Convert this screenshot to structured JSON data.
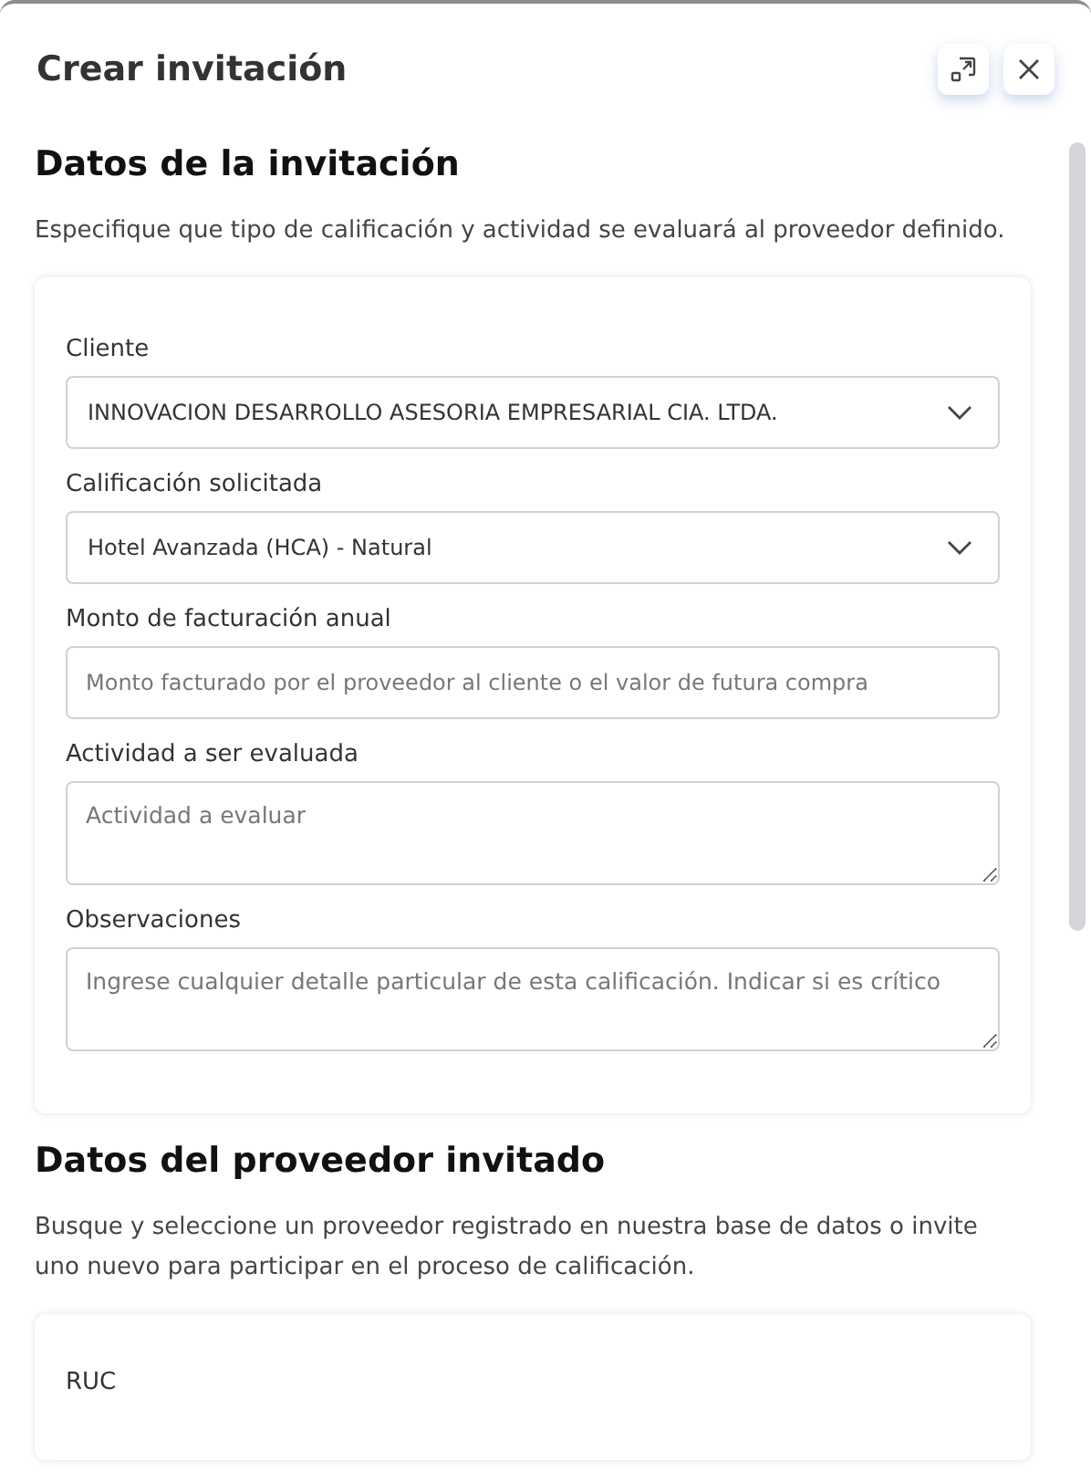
{
  "dialog": {
    "title": "Crear invitación"
  },
  "sections": [
    {
      "title": "Datos de la invitación",
      "description": "Especifique que tipo de calificación y actividad se evaluará al proveedor definido.",
      "fields": [
        {
          "kind": "select",
          "label": "Cliente",
          "value": "INNOVACION DESARROLLO ASESORIA EMPRESARIAL CIA. LTDA."
        },
        {
          "kind": "select",
          "label": "Calificación solicitada",
          "value": "Hotel Avanzada (HCA) - Natural"
        },
        {
          "kind": "input",
          "label": "Monto de facturación anual",
          "placeholder": "Monto facturado por el proveedor al cliente o el valor de futura compra"
        },
        {
          "kind": "textarea",
          "label": "Actividad a ser evaluada",
          "placeholder": "Actividad a evaluar"
        },
        {
          "kind": "textarea",
          "label": "Observaciones",
          "placeholder": "Ingrese cualquier detalle particular de esta calificación. Indicar si es crítico"
        }
      ]
    },
    {
      "title": "Datos del proveedor invitado",
      "description": "Busque y seleccione un proveedor registrado en nuestra base de datos o invite uno nuevo para participar en el proceso de calificación.",
      "fields": [
        {
          "kind": "label",
          "label": "RUC"
        }
      ]
    }
  ]
}
